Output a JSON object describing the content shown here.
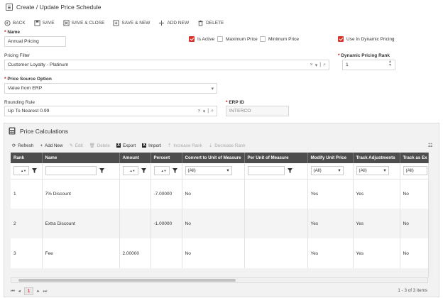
{
  "window": {
    "title": "Create / Update Price Schedule"
  },
  "toolbar": {
    "back": "BACK",
    "save": "SAVE",
    "save_close": "SAVE & CLOSE",
    "save_new": "SAVE & NEW",
    "add_new": "ADD NEW",
    "delete": "DELETE"
  },
  "form": {
    "name_label": "Name",
    "name_value": "Annual Pricing",
    "is_active_label": "Is Active",
    "max_price_label": "Maximum Price",
    "min_price_label": "Minimum Price",
    "dynamic_label": "Use In Dynamic Pricing",
    "pricing_filter_label": "Pricing Filter",
    "pricing_filter_value": "Customer Loyalty - Platinum",
    "dyn_rank_label": "Dynamic Pricing Rank",
    "dyn_rank_value": "1",
    "price_source_label": "Price Source Option",
    "price_source_value": "Value from ERP",
    "rounding_label": "Rounding Rule",
    "rounding_value": "Up To Nearest 0.99",
    "erp_label": "ERP ID",
    "erp_value": "INTERCO"
  },
  "calc": {
    "title": "Price Calculations",
    "toolbar": {
      "refresh": "Refresh",
      "add_new": "Add New",
      "edit": "Edit",
      "delete": "Delete",
      "export": "Export",
      "import": "Import",
      "increase": "Increase Rank",
      "decrease": "Decrease Rank"
    },
    "columns": [
      "Rank",
      "Name",
      "Amount",
      "Percent",
      "Convert to Unit of Measure",
      "Per Unit of Measure",
      "Modify Unit Price",
      "Track Adjustments",
      "Track as Ex"
    ],
    "filter_all": "(All)",
    "rows": [
      {
        "rank": "1",
        "name": "7% Discount",
        "amount": "",
        "percent": "-7.00000",
        "convert": "No",
        "per_unit": "",
        "modify": "Yes",
        "track_adj": "Yes",
        "track_ex": "No"
      },
      {
        "rank": "2",
        "name": "Extra Discount",
        "amount": "",
        "percent": "-1.00000",
        "convert": "No",
        "per_unit": "",
        "modify": "Yes",
        "track_adj": "Yes",
        "track_ex": "No"
      },
      {
        "rank": "3",
        "name": "Fee",
        "amount": "2.00000",
        "percent": "",
        "convert": "No",
        "per_unit": "",
        "modify": "Yes",
        "track_adj": "Yes",
        "track_ex": "No"
      }
    ],
    "pager": {
      "current": "1",
      "summary": "1 - 3 of 3 items"
    }
  },
  "colors": {
    "accent": "#d9342b",
    "header_bg": "#4d4d4d"
  }
}
